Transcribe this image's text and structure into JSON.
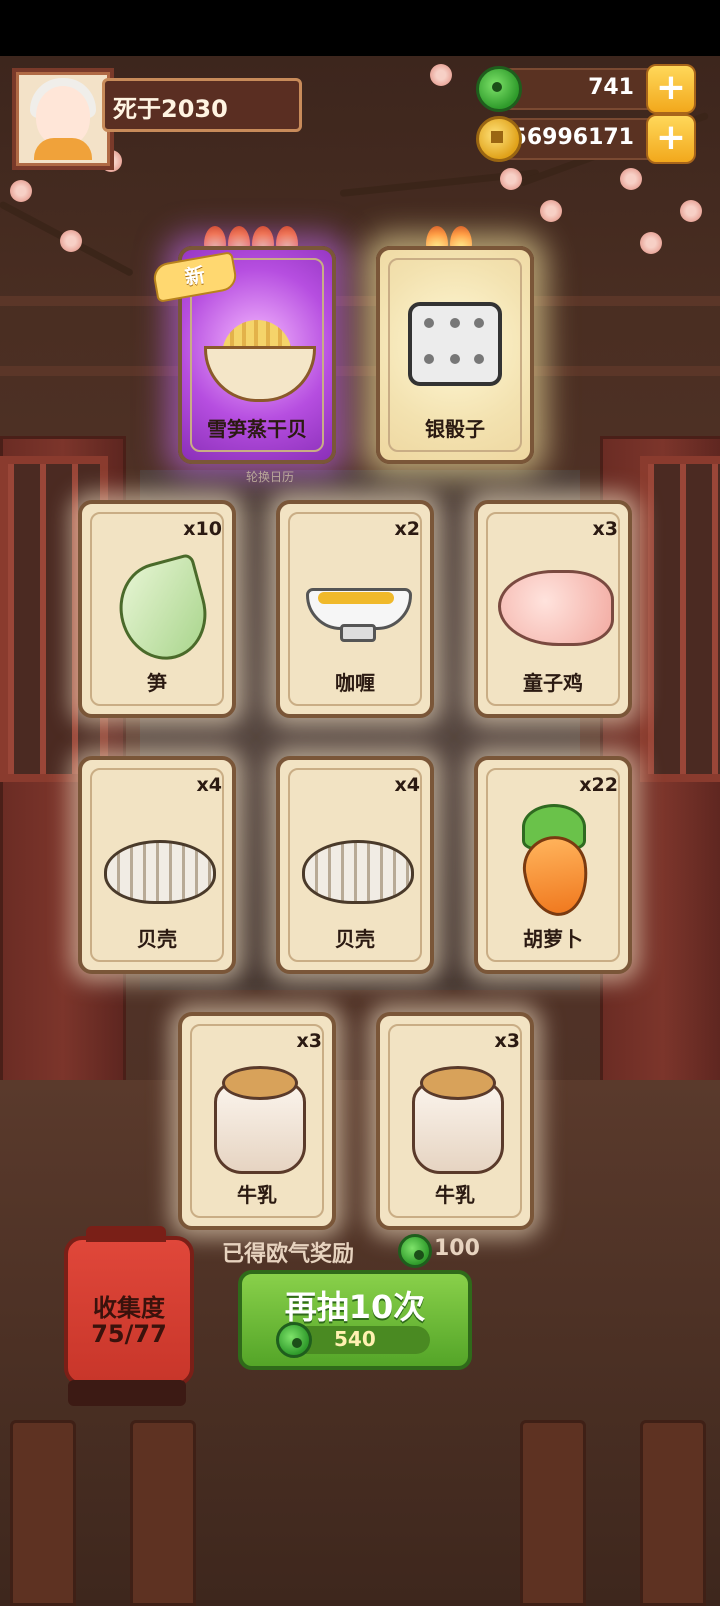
{
  "player": {
    "name": "死于2030"
  },
  "currencies": [
    {
      "icon": "jade-icon",
      "value": "741"
    },
    {
      "icon": "coin-icon",
      "value": "56996171"
    }
  ],
  "new_badge": "新",
  "featured": [
    {
      "name": "雪笋蒸干贝",
      "flames": 4,
      "is_new": true,
      "rarity_color": "#b64ee0"
    },
    {
      "name": "银骰子",
      "flames": 2,
      "is_new": false,
      "rarity_color": "#f3e2b0"
    }
  ],
  "calendar_caption": "轮换日历",
  "items": [
    {
      "name": "笋",
      "count": "x10",
      "icon": "bamboo-shoot-icon"
    },
    {
      "name": "咖喱",
      "count": "x2",
      "icon": "curry-icon"
    },
    {
      "name": "童子鸡",
      "count": "x3",
      "icon": "chicken-icon"
    },
    {
      "name": "贝壳",
      "count": "x4",
      "icon": "shell-icon"
    },
    {
      "name": "贝壳",
      "count": "x4",
      "icon": "shell-icon"
    },
    {
      "name": "胡萝卜",
      "count": "x22",
      "icon": "carrot-icon"
    },
    {
      "name": "牛乳",
      "count": "x3",
      "icon": "milk-jar-icon"
    },
    {
      "name": "牛乳",
      "count": "x3",
      "icon": "milk-jar-icon"
    }
  ],
  "reward": {
    "label": "已得欧气奖励",
    "value": "100"
  },
  "collection": {
    "label": "收集度",
    "progress": "75/77"
  },
  "draw_button": {
    "label": "再抽10次",
    "cost": "540"
  }
}
